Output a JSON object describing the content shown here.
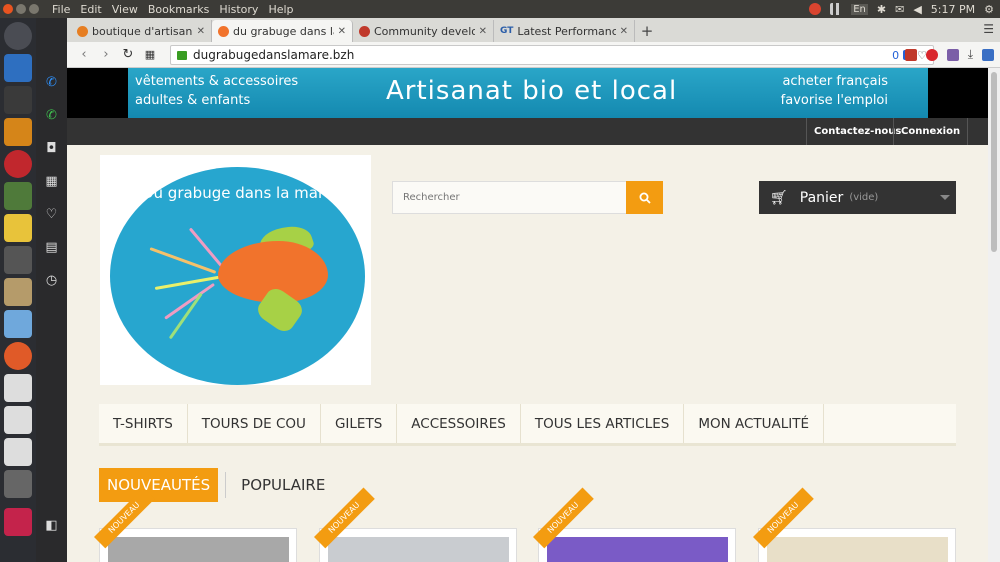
{
  "menubar": {
    "items": [
      "File",
      "Edit",
      "View",
      "Bookmarks",
      "History",
      "Help"
    ],
    "lang": "En",
    "clock": "5:17 PM"
  },
  "tabs": [
    {
      "title": "boutique d'artisane",
      "active": false
    },
    {
      "title": "du grabuge dans la m",
      "active": true
    },
    {
      "title": "Community develop",
      "active": false
    },
    {
      "title": "Latest Performance",
      "active": false,
      "prefix": "GT"
    }
  ],
  "navbar": {
    "url": "dugrabugedanslamare.bzh",
    "badge": "0"
  },
  "banner": {
    "left1": "vêtements & accessoires",
    "left2": "adultes & enfants",
    "title": "Artisanat bio et local",
    "right1": "acheter français",
    "right2": "favorise l'emploi"
  },
  "userbar": {
    "contact": "Contactez-nous",
    "login": "Connexion"
  },
  "logo": {
    "text": "Du grabuge dans la mare"
  },
  "search": {
    "placeholder": "Rechercher"
  },
  "cart": {
    "label": "Panier",
    "status": "(vide)"
  },
  "menu": [
    "T-SHIRTS",
    "TOURS DE COU",
    "GILETS",
    "ACCESSOIRES",
    "TOUS LES ARTICLES",
    "MON ACTUALITÉ"
  ],
  "product_tabs": [
    "NOUVEAUTÉS",
    "POPULAIRE"
  ],
  "products": [
    {
      "badge": "NOUVEAU"
    },
    {
      "badge": "NOUVEAU"
    },
    {
      "badge": "NOUVEAU"
    },
    {
      "badge": "NOUVEAU"
    }
  ],
  "colors": {
    "accent": "#f39c11",
    "banner": "#1e98bf",
    "dark": "#333333"
  }
}
